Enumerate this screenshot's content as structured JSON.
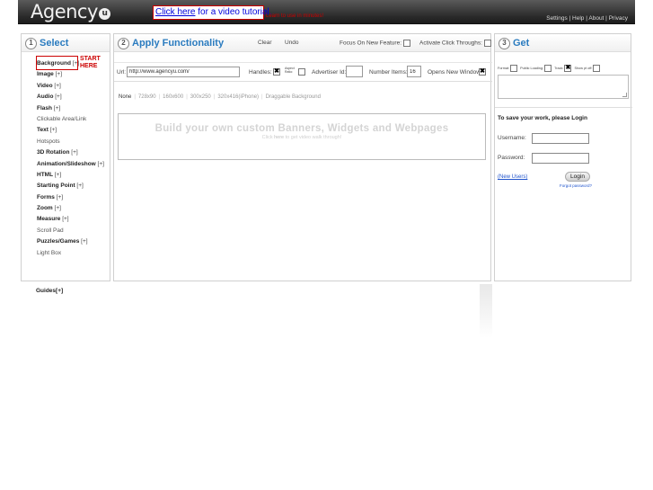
{
  "header": {
    "logo_text": "Agency",
    "logo_badge": "u",
    "tutorial": {
      "link": "Click here",
      "rest": " for a video tutorial."
    },
    "learn_text": "Learn to use in minutes!",
    "links": [
      "Settings",
      "Help",
      "About",
      "Privacy"
    ],
    "separator": " | "
  },
  "select_panel": {
    "number": "1",
    "title": "Select",
    "items": [
      {
        "label": "Background",
        "suffix": "[+]",
        "bold": true
      },
      {
        "label": "Image",
        "suffix": "[+]",
        "bold": true
      },
      {
        "label": "Video",
        "suffix": "[+]",
        "bold": true
      },
      {
        "label": "Audio",
        "suffix": "[+]",
        "bold": true
      },
      {
        "label": "Flash",
        "suffix": "[+]",
        "bold": true
      },
      {
        "label": "Clickable Area/Link",
        "suffix": "",
        "bold": false
      },
      {
        "label": "Text",
        "suffix": "[+]",
        "bold": true
      },
      {
        "label": "Hotspots",
        "suffix": "",
        "bold": false
      },
      {
        "label": "3D Rotation",
        "suffix": "[+]",
        "bold": true
      },
      {
        "label": "Animation/Slideshow",
        "suffix": "[+]",
        "bold": true
      },
      {
        "label": "HTML",
        "suffix": "[+]",
        "bold": true
      },
      {
        "label": "Starting Point",
        "suffix": "[+]",
        "bold": true
      },
      {
        "label": "Forms",
        "suffix": "[+]",
        "bold": true
      },
      {
        "label": "Zoom",
        "suffix": "[+]",
        "bold": true
      },
      {
        "label": "Measure",
        "suffix": "[+]",
        "bold": true
      },
      {
        "label": "Scroll Pad",
        "suffix": "",
        "bold": false
      },
      {
        "label": "Puzzles/Games",
        "suffix": "[+]",
        "bold": true
      },
      {
        "label": "Light Box",
        "suffix": "",
        "bold": false
      }
    ],
    "start_here": [
      "START",
      "HERE"
    ],
    "guides": "Guides[+]"
  },
  "apply_panel": {
    "number": "2",
    "title": "Apply Functionality",
    "clear": "Clear",
    "undo": "Undo",
    "focus_label": "Focus On New Feature:",
    "activate_label": "Activate Click Throughs:",
    "url_label": "Url:",
    "url_value": "http://www.agencyu.com/",
    "handles_label": "Handles:",
    "handles_checked": true,
    "aspect_label": [
      "Aspect",
      "Ratio:"
    ],
    "advertiser_label": "Advertiser Id:",
    "advertiser_value": "",
    "number_items_label": "Number Items:",
    "number_items_value": "16",
    "opens_label": "Opens New Window:",
    "opens_checked": true,
    "sizes": [
      "None",
      "728x90",
      "160x600",
      "300x250",
      "320x416(iPhone)",
      "Draggable Background"
    ],
    "canvas_title": "Build your own custom Banners, Widgets and Webpages",
    "canvas_sub_pre": "Click ",
    "canvas_sub_link": "here",
    "canvas_sub_post": " to get video walk through!"
  },
  "get_panel": {
    "number": "3",
    "title": "Get",
    "options": [
      {
        "label": "Format:",
        "checked": false
      },
      {
        "label": "Public Loading:",
        "checked": false
      },
      {
        "label": "Track:",
        "checked": true
      },
      {
        "label": "Show pt off:",
        "checked": false
      }
    ],
    "save_text": "To save your work, please Login",
    "username_label": "Username:",
    "password_label": "Password:",
    "new_users": "(New Users)",
    "login_label": "Login",
    "forgot": "Forgot password?"
  }
}
